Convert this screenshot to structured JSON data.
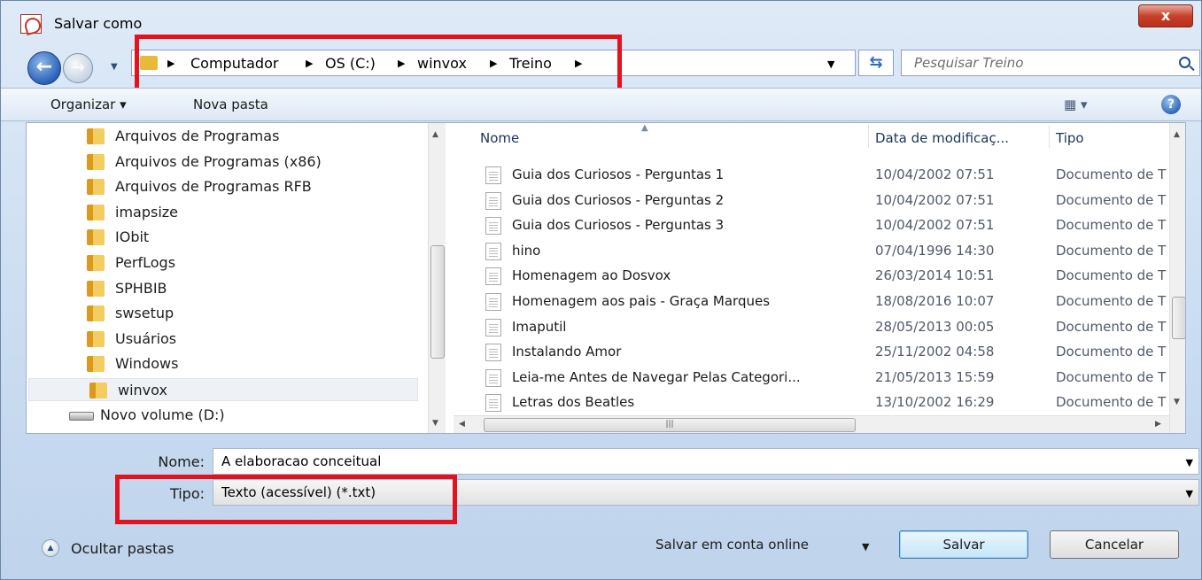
{
  "window": {
    "title": "Salvar como",
    "close_label": "x"
  },
  "nav": {
    "back_icon": "back-arrow-icon",
    "forward_icon": "forward-arrow-icon",
    "breadcrumbs": [
      "Computador",
      "OS (C:)",
      "winvox",
      "Treino"
    ],
    "refresh_glyph": "⇆",
    "search_placeholder": "Pesquisar Treino"
  },
  "toolbar": {
    "organizar_label": "Organizar ▾",
    "nova_pasta_label": "Nova pasta",
    "view_label": "▦ ▾",
    "help_label": "?"
  },
  "tree": {
    "items": [
      {
        "label": "Arquivos de Programas",
        "kind": "folder"
      },
      {
        "label": "Arquivos de Programas (x86)",
        "kind": "folder"
      },
      {
        "label": "Arquivos de Programas RFB",
        "kind": "folder"
      },
      {
        "label": "imapsize",
        "kind": "folder"
      },
      {
        "label": "IObit",
        "kind": "folder"
      },
      {
        "label": "PerfLogs",
        "kind": "folder"
      },
      {
        "label": "SPHBIB",
        "kind": "folder"
      },
      {
        "label": "swsetup",
        "kind": "folder"
      },
      {
        "label": "Usuários",
        "kind": "folder"
      },
      {
        "label": "Windows",
        "kind": "folder"
      },
      {
        "label": "winvox",
        "kind": "folder",
        "selected": true
      },
      {
        "label": "Novo volume (D:)",
        "kind": "drive"
      }
    ]
  },
  "files": {
    "columns": {
      "name": "Nome",
      "date": "Data de modificaç...",
      "type": "Tipo"
    },
    "rows": [
      {
        "name": "Guia dos Curiosos - Perguntas 1",
        "date": "10/04/2002 07:51",
        "type": "Documento de T"
      },
      {
        "name": "Guia dos Curiosos - Perguntas 2",
        "date": "10/04/2002 07:51",
        "type": "Documento de T"
      },
      {
        "name": "Guia dos Curiosos - Perguntas 3",
        "date": "10/04/2002 07:51",
        "type": "Documento de T"
      },
      {
        "name": "hino",
        "date": "07/04/1996 14:30",
        "type": "Documento de T"
      },
      {
        "name": "Homenagem ao Dosvox",
        "date": "26/03/2014 10:51",
        "type": "Documento de T"
      },
      {
        "name": "Homenagem aos pais - Graça Marques",
        "date": "18/08/2016 10:07",
        "type": "Documento de T"
      },
      {
        "name": "Imaputil",
        "date": "28/05/2013 00:05",
        "type": "Documento de T"
      },
      {
        "name": "Instalando Amor",
        "date": "25/11/2002 04:58",
        "type": "Documento de T"
      },
      {
        "name": "Leia-me Antes de Navegar Pelas Categori...",
        "date": "21/05/2013 15:59",
        "type": "Documento de T"
      },
      {
        "name": "Letras dos Beatles",
        "date": "13/10/2002 16:29",
        "type": "Documento de T"
      }
    ]
  },
  "form": {
    "nome_label": "Nome:",
    "nome_value": "A elaboracao conceitual",
    "tipo_label": "Tipo:",
    "tipo_value": "Texto (acessível) (*.txt)"
  },
  "footer": {
    "ocultar_label": "Ocultar pastas",
    "online_label": "Salvar em conta online",
    "save_label": "Salvar",
    "cancel_label": "Cancelar"
  },
  "colors": {
    "highlight_box": "#e3121e",
    "window_chrome": "#c9dcf1"
  }
}
